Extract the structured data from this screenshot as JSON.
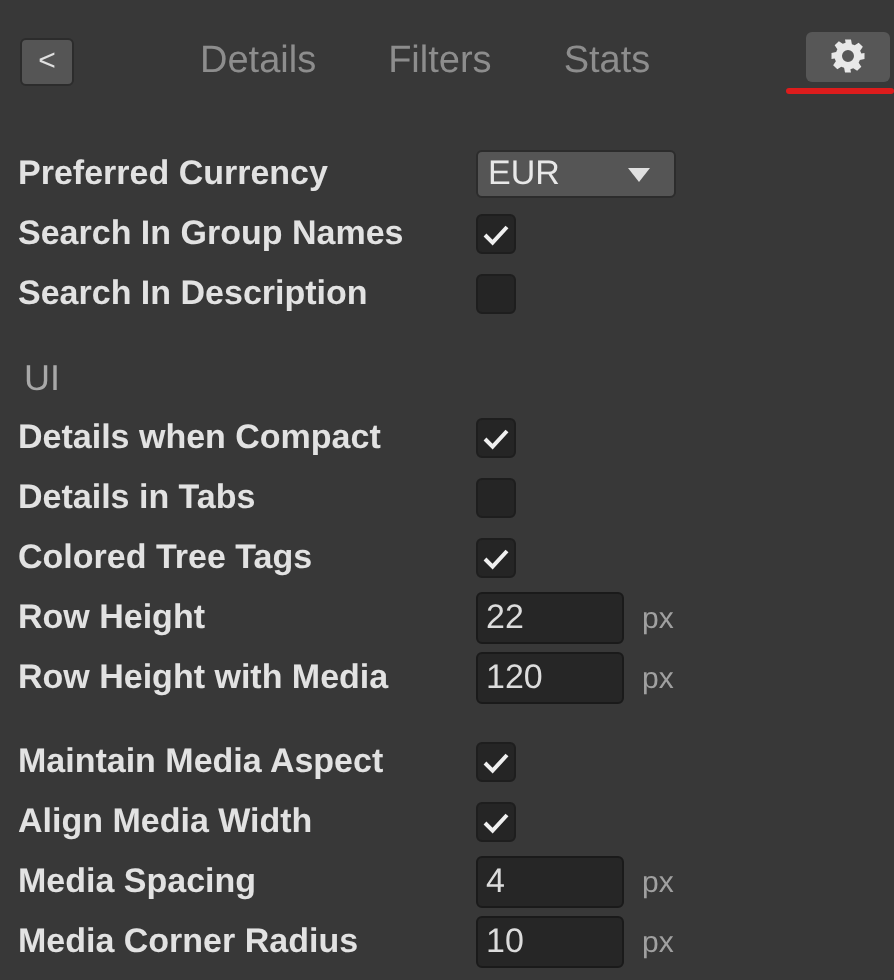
{
  "back_button": {
    "label": "<"
  },
  "tabs": [
    {
      "kind": "text",
      "label": "Details",
      "selected": false
    },
    {
      "kind": "text",
      "label": "Filters",
      "selected": false
    },
    {
      "kind": "text",
      "label": "Stats",
      "selected": false
    },
    {
      "kind": "gear",
      "selected": true
    }
  ],
  "sections": [
    {
      "rows": [
        {
          "kind": "select",
          "label": "Preferred Currency",
          "value": "EUR"
        },
        {
          "kind": "check",
          "label": "Search In Group Names",
          "checked": true
        },
        {
          "kind": "check",
          "label": "Search In Description",
          "checked": false
        }
      ]
    },
    {
      "title": "UI",
      "rows": [
        {
          "kind": "check",
          "label": "Details when Compact",
          "checked": true
        },
        {
          "kind": "check",
          "label": "Details in Tabs",
          "checked": false
        },
        {
          "kind": "check",
          "label": "Colored Tree Tags",
          "checked": true
        },
        {
          "kind": "number",
          "label": "Row Height",
          "value": "22",
          "unit": "px"
        },
        {
          "kind": "number",
          "label": "Row Height with Media",
          "value": "120",
          "unit": "px"
        }
      ]
    },
    {
      "rows": [
        {
          "kind": "check",
          "label": "Maintain Media Aspect",
          "checked": true
        },
        {
          "kind": "check",
          "label": "Align Media Width",
          "checked": true
        },
        {
          "kind": "number",
          "label": "Media Spacing",
          "value": "4",
          "unit": "px"
        },
        {
          "kind": "number",
          "label": "Media Corner Radius",
          "value": "10",
          "unit": "px"
        }
      ]
    }
  ]
}
